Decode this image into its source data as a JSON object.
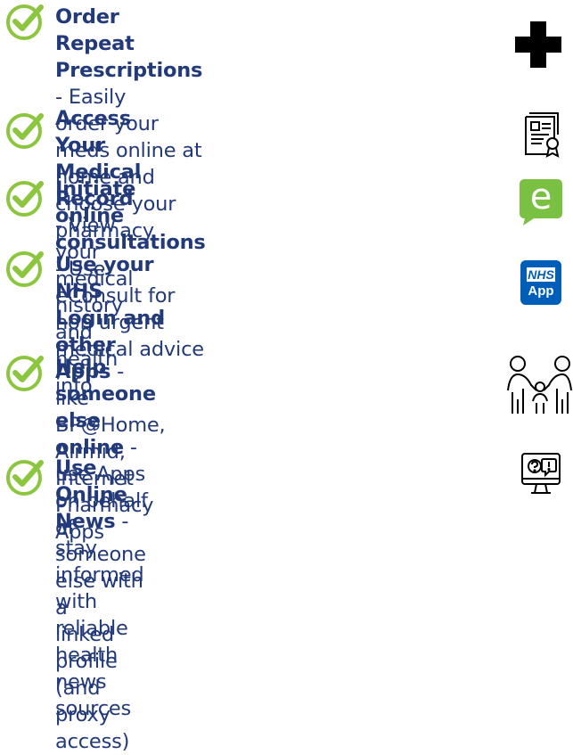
{
  "items": [
    {
      "title": "Order Repeat Prescriptions",
      "sep": " - ",
      "line1": "Easily",
      "line2": "order your meds online at home and",
      "line3": "choose your pharmacy",
      "icon": "medical-cross-icon"
    },
    {
      "title": "Access Your Medical Record",
      "sep": " - ",
      "line1": "View",
      "line2": "your medical history and health info",
      "icon": "medical-record-icon"
    },
    {
      "title": "Initiate online consultations",
      "sep": " - ",
      "line1": "Use",
      "line2": "eConsult for non urgent medical advice",
      "icon": "econsult-logo-icon"
    },
    {
      "title": "Use your NHS Login and other Apps",
      "sep": " -",
      "line1": "",
      "line2": "like BP@Home, Airmid, Internet",
      "line3": "Pharmacy Apps",
      "icon": "nhs-app-icon"
    },
    {
      "title": "Help someone else online",
      "sep": " - ",
      "line1": "use Apps",
      "line2": "on behalf of someone else with a",
      "line3": "linked profile (and proxy access)",
      "icon": "family-icon"
    },
    {
      "title": "Use Online News",
      "sep": " - ",
      "line1": "stay informed with",
      "line2": "reliable health news sources",
      "icon": "online-news-icon"
    }
  ],
  "logos": {
    "econsult": "e",
    "nhs": "NHS",
    "app": "App"
  },
  "colors": {
    "text": "#223a7a",
    "check": "#8cc63f",
    "econsult": "#7ac143",
    "nhs_blue": "#005eb8"
  }
}
